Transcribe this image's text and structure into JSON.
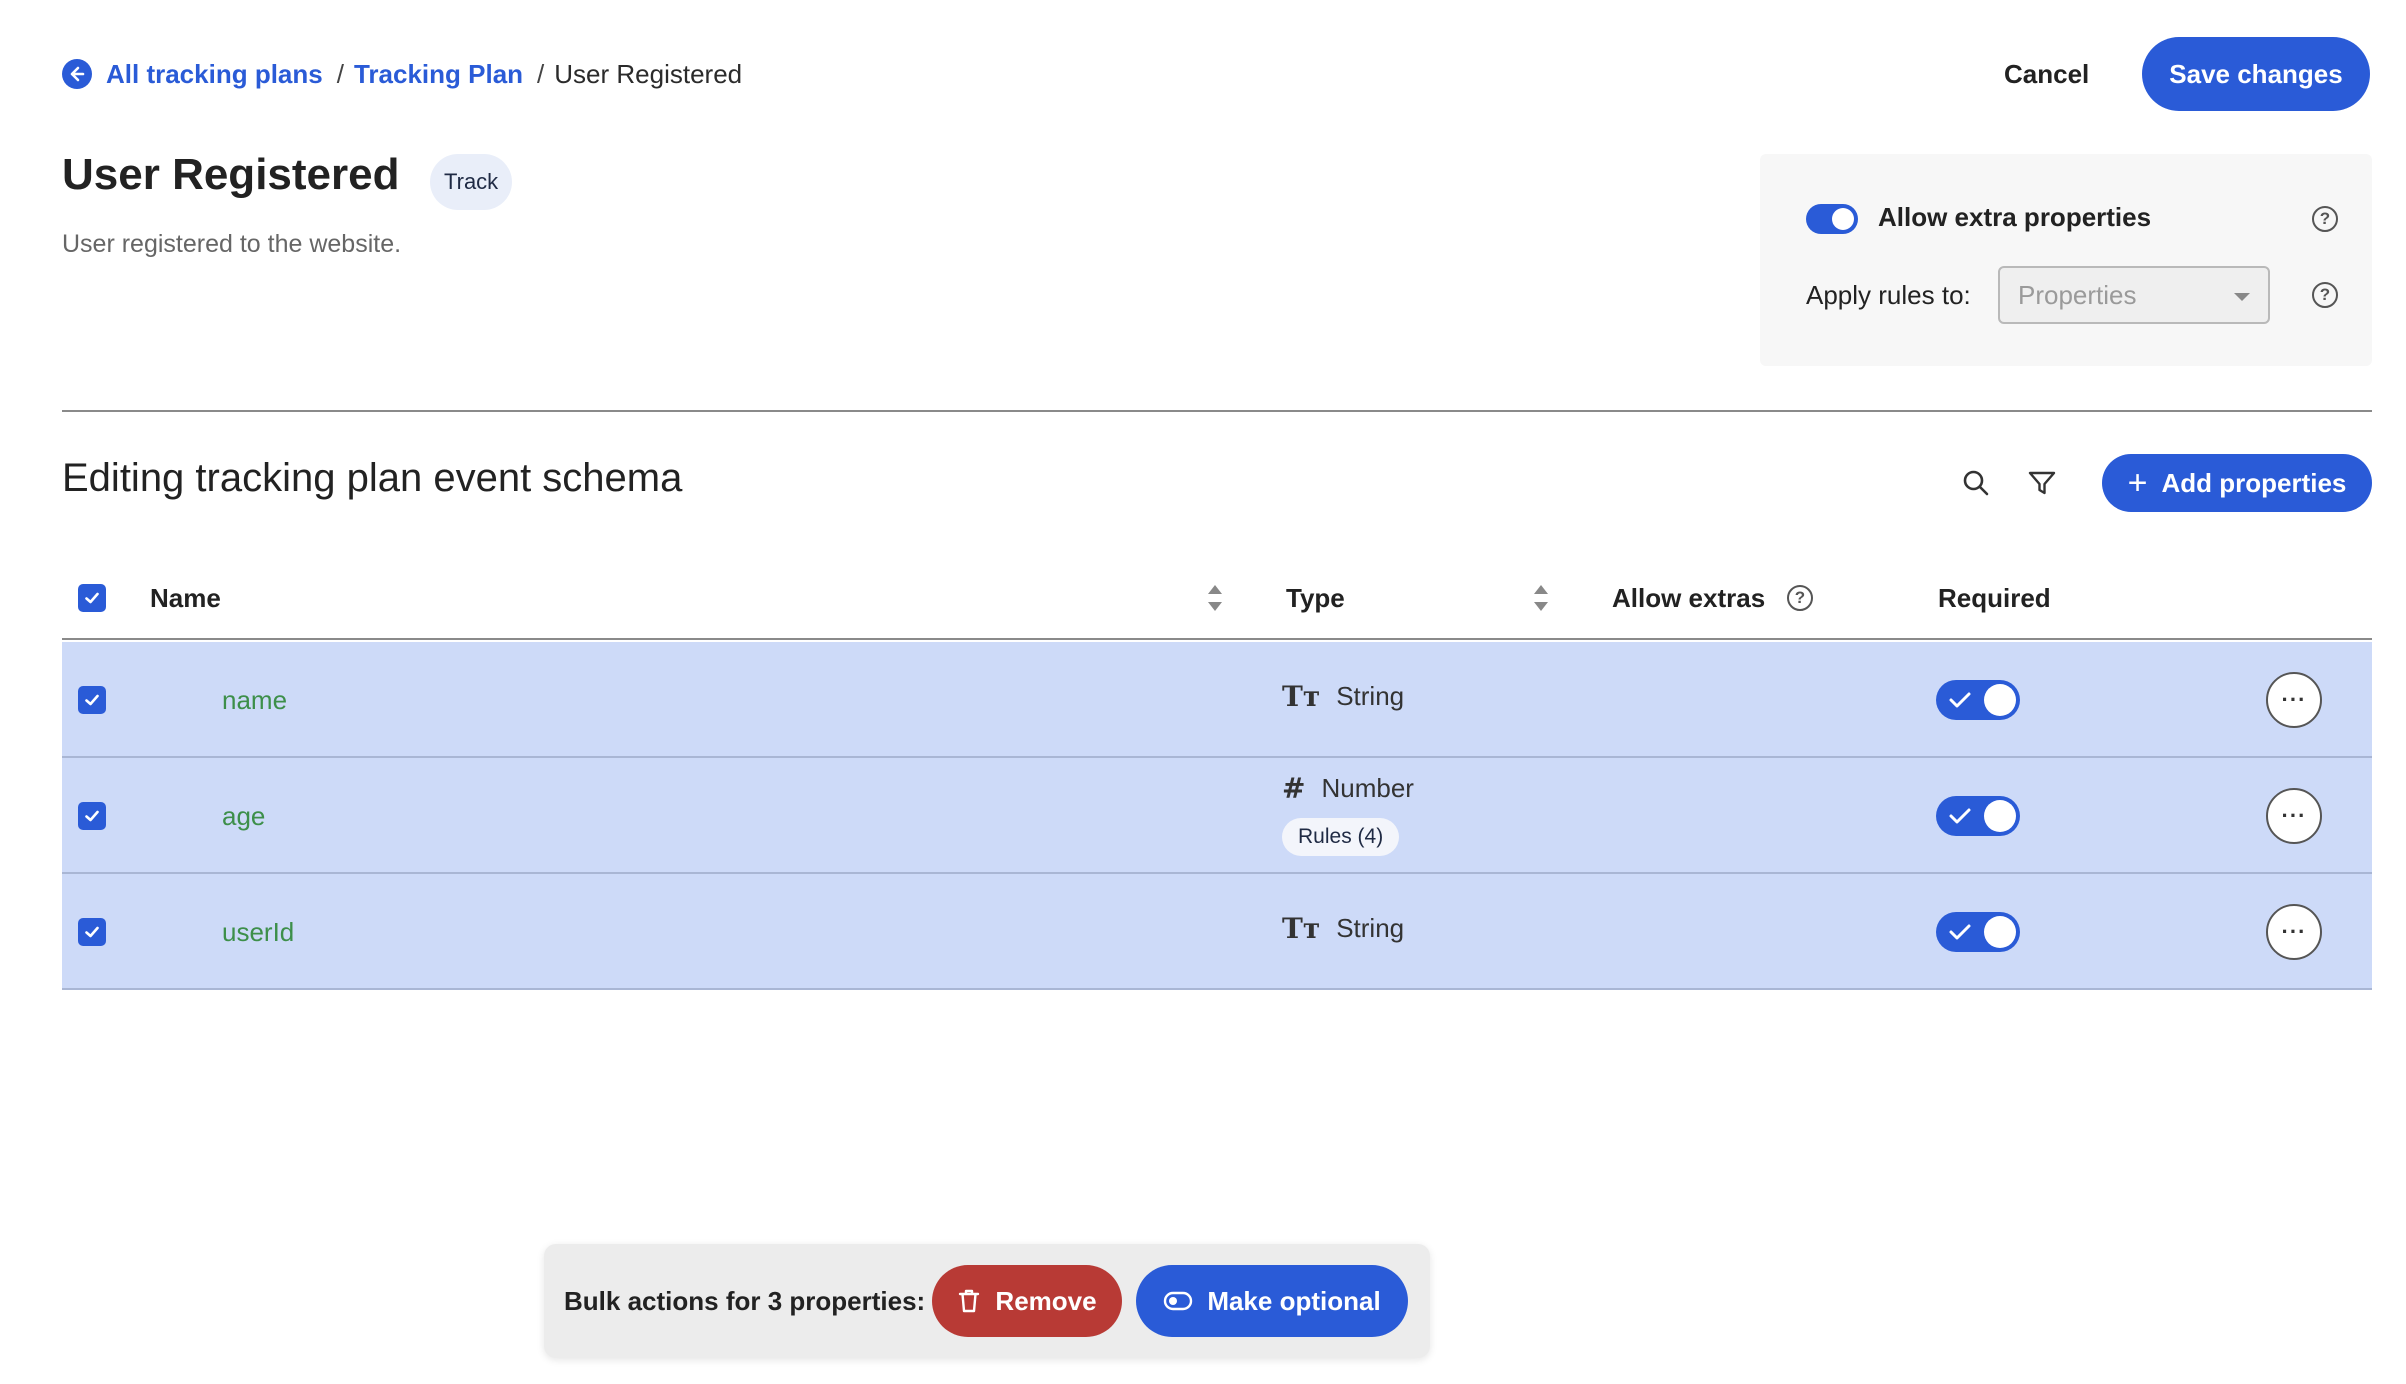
{
  "breadcrumb": {
    "items": [
      "All tracking plans",
      "Tracking Plan"
    ],
    "separator": "/",
    "current": "User Registered"
  },
  "header": {
    "cancel_label": "Cancel",
    "save_label": "Save changes",
    "title": "User Registered",
    "badge": "Track",
    "description": "User registered to the website."
  },
  "settings": {
    "allow_extra_label": "Allow extra properties",
    "allow_extra_enabled": true,
    "apply_rules_label": "Apply rules to:",
    "apply_rules_placeholder": "Properties",
    "help_glyph": "?"
  },
  "schema": {
    "title": "Editing tracking plan event schema",
    "add_label": "Add properties",
    "add_glyph": "+",
    "columns": {
      "name": "Name",
      "type": "Type",
      "allow_extras": "Allow extras",
      "required": "Required"
    },
    "rows": [
      {
        "name": "name",
        "type": "String",
        "type_glyph": "Tт",
        "rules": null,
        "required": true,
        "selected": true
      },
      {
        "name": "age",
        "type": "Number",
        "type_glyph": "#",
        "rules": "Rules (4)",
        "required": true,
        "selected": true
      },
      {
        "name": "userId",
        "type": "String",
        "type_glyph": "Tт",
        "rules": null,
        "required": true,
        "selected": true
      }
    ],
    "more_glyph": "···"
  },
  "bulk": {
    "label": "Bulk actions for 3 properties:",
    "remove_label": "Remove",
    "optional_label": "Make optional"
  },
  "colors": {
    "primary": "#2a5bd7",
    "danger": "#b83a35",
    "row_selected": "#cddaf8",
    "property_name": "#3d8f4a"
  }
}
